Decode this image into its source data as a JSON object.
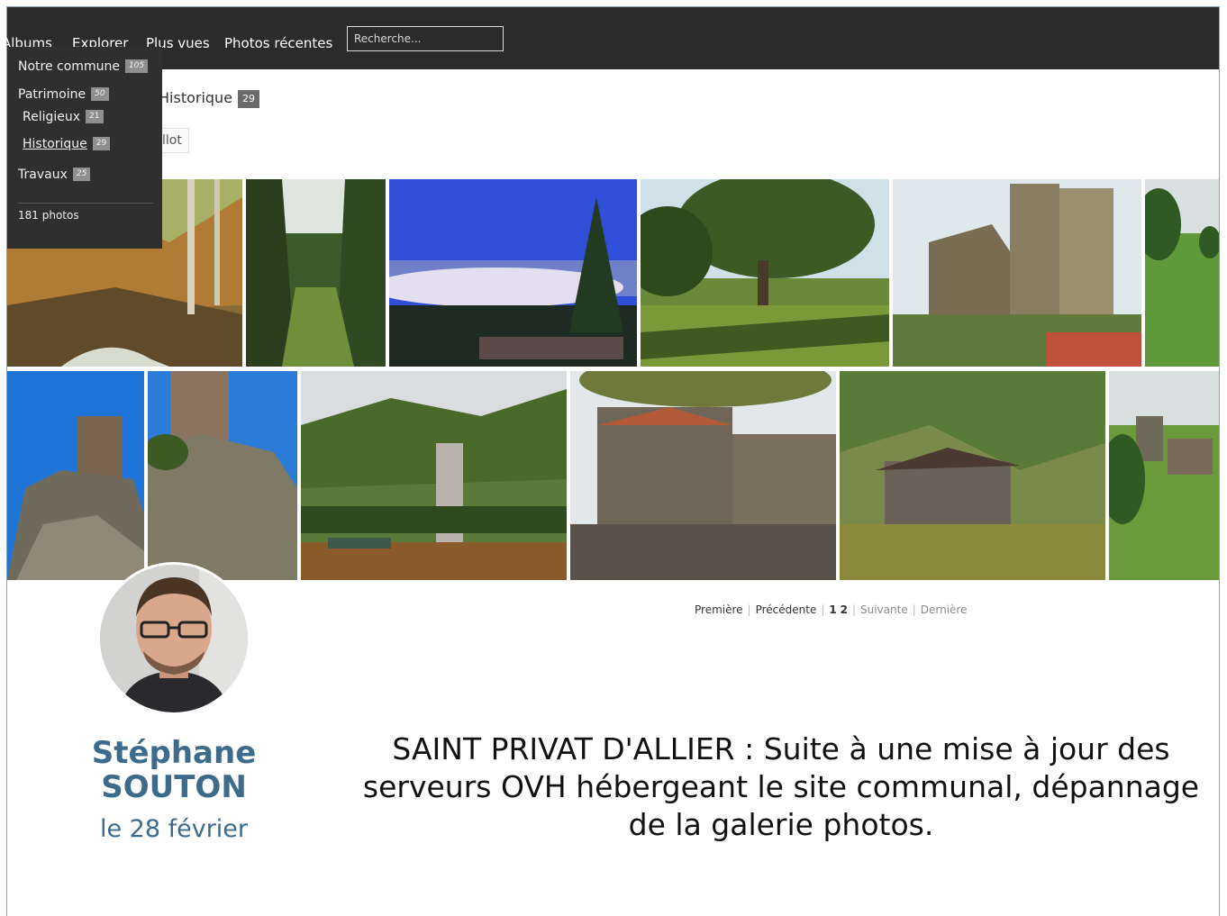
{
  "nav": {
    "items": [
      "Albums",
      "Explorer",
      "Plus vues",
      "Photos récentes"
    ],
    "search_placeholder": "Recherche..."
  },
  "dropdown": {
    "items": [
      {
        "label": "Notre commune",
        "count": "105"
      },
      {
        "label": "Patrimoine",
        "count": "50"
      },
      {
        "label": "Religieux",
        "count": "21"
      },
      {
        "label": "Historique",
        "count": "29"
      },
      {
        "label": "Travaux",
        "count": "25"
      }
    ],
    "total": "181 photos"
  },
  "breadcrumb": {
    "label": "Historique",
    "count": "29"
  },
  "chip_text": "llot",
  "photos": [
    {
      "icon": "autumn-forest-stream-photo"
    },
    {
      "icon": "forest-path-photo"
    },
    {
      "icon": "sea-of-clouds-pine-photo"
    },
    {
      "icon": "park-tree-shade-photo"
    },
    {
      "icon": "castle-ruin-towers-photo"
    },
    {
      "icon": "green-meadow-photo"
    },
    {
      "icon": "rock-tower-blue-sky-photo"
    },
    {
      "icon": "rock-tower-closeup-photo"
    },
    {
      "icon": "statue-park-bench-photo"
    },
    {
      "icon": "stone-manor-house-photo"
    },
    {
      "icon": "hillside-chateau-photo"
    },
    {
      "icon": "castle-on-hill-photo"
    }
  ],
  "pager": {
    "first": "Première",
    "prev": "Précédente",
    "page1": "1",
    "page2": "2",
    "next": "Suivante",
    "last": "Dernière"
  },
  "author": {
    "first": "Stéphane",
    "last": "SOUTON",
    "date": "le 28 février"
  },
  "headline": "SAINT PRIVAT D'ALLIER : Suite à une mise à jour des serveurs OVH hébergeant le site communal, dépannage de la galerie photos.",
  "colors": {
    "navbar": "#2b2b2b",
    "author": "#3d6b8c"
  }
}
